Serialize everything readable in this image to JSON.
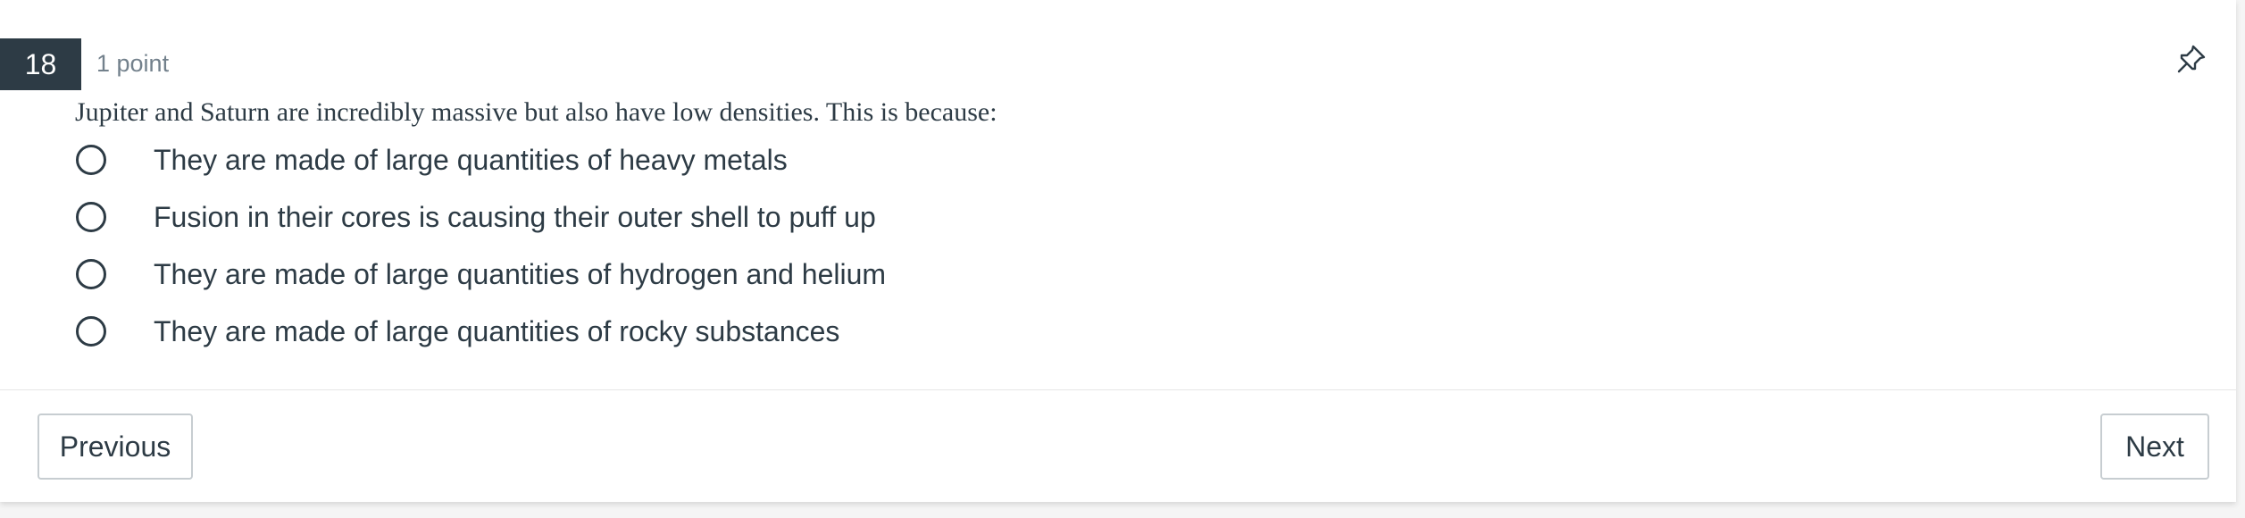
{
  "question": {
    "number": "18",
    "points": "1 point",
    "text": "Jupiter and Saturn are incredibly massive but also have low densities. This is because:",
    "pin_icon": "pin-icon"
  },
  "answers": [
    {
      "label": "They are made of large quantities of heavy metals",
      "selected": false
    },
    {
      "label": "Fusion in their cores is causing their outer shell to puff up",
      "selected": false
    },
    {
      "label": "They are made of large quantities of hydrogen and helium",
      "selected": false
    },
    {
      "label": "They are made of large quantities of rocky substances",
      "selected": false
    }
  ],
  "navigation": {
    "previous_label": "Previous",
    "next_label": "Next"
  },
  "colors": {
    "header_badge": "#2d3b45",
    "text": "#2d3b45",
    "muted": "#73818c",
    "border": "#c7cdd1"
  }
}
